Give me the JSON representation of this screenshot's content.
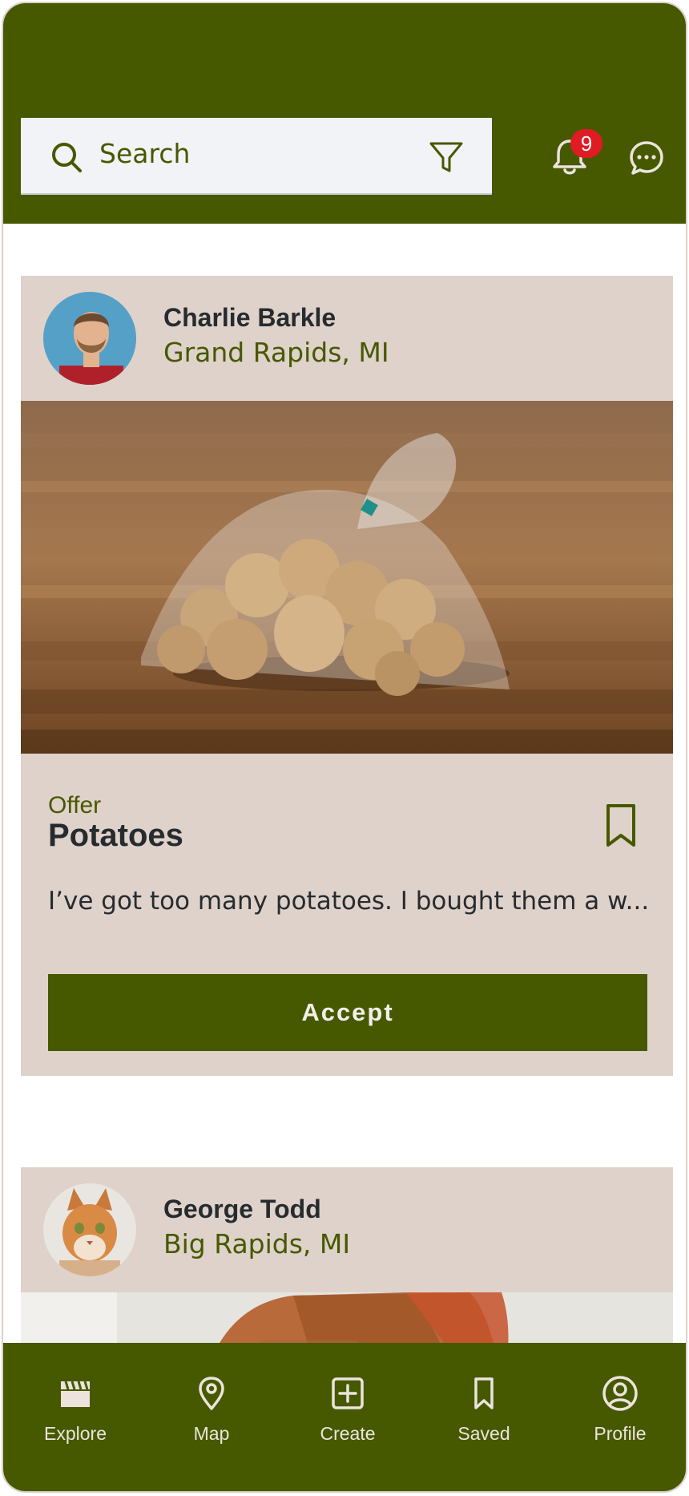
{
  "search": {
    "placeholder": "Search"
  },
  "notifications": {
    "count": "9"
  },
  "posts": [
    {
      "user_name": "Charlie Barkle",
      "location": "Grand Rapids, MI",
      "type": "Offer",
      "title": "Potatoes",
      "description": "I’ve got too many potatoes. I bought them a w...",
      "action_label": "Accept"
    },
    {
      "user_name": "George Todd",
      "location": "Big Rapids, MI"
    }
  ],
  "nav": {
    "items": [
      {
        "label": "Explore",
        "icon": "clapperboard-icon"
      },
      {
        "label": "Map",
        "icon": "map-pin-icon"
      },
      {
        "label": "Create",
        "icon": "plus-square-icon"
      },
      {
        "label": "Saved",
        "icon": "bookmark-icon"
      },
      {
        "label": "Profile",
        "icon": "user-circle-icon"
      }
    ]
  },
  "colors": {
    "primary": "#465900",
    "card_background": "#dfd2ca",
    "badge": "#e01b24",
    "text_dark": "#262b2f",
    "search_background": "#f2f3f7"
  }
}
